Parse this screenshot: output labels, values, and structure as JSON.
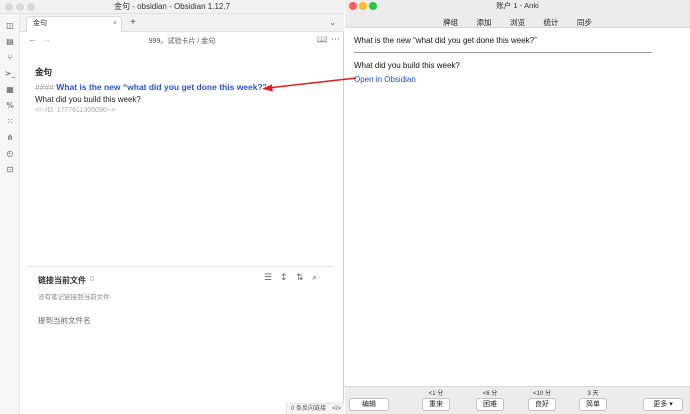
{
  "obsidian": {
    "window_title": "金句 - obsidian - Obsidian 1.12.7",
    "tab": {
      "label": "金句",
      "close": "×"
    },
    "new_tab": "+",
    "tab_menu": "⌄",
    "nav": {
      "back": "←",
      "forward": "→",
      "breadcrumb": "999。试验卡片 / 金句",
      "reading_icon": "📖",
      "more_icon": "⋯"
    },
    "note": {
      "title": "金句",
      "heading_marks": "####",
      "heading_text": "What is the new “what did you get done this week?”",
      "body": "What did you build this week?",
      "comment": "<!--ID: 1777611305090-->"
    },
    "backlinks": {
      "title": "链接当前文件",
      "count": "0",
      "empty_text": "没有笔记链接到当前文件",
      "mentions_title": "提到当前文件名"
    },
    "status": "0 条反向链接"
  },
  "anki": {
    "window_title": "账户 1 - Anki",
    "menu": [
      "牌组",
      "添加",
      "浏览",
      "统计",
      "同步"
    ],
    "card": {
      "front": "What is the new “what did you get done this week?”",
      "back": "What did you build this week?",
      "link": "Open in Obsidian"
    },
    "bottom": {
      "edit_label": "编辑",
      "more_label": "更多 ▾",
      "answers": [
        {
          "time": "<1 分",
          "label": "重来"
        },
        {
          "time": "<6 分",
          "label": "困难"
        },
        {
          "time": "<10 分",
          "label": "良好"
        },
        {
          "time": "3 天",
          "label": "简单"
        }
      ]
    }
  },
  "colors": {
    "heading_link": "#2b56c5",
    "anki_link": "#1d4fd8",
    "arrow": "#e02020"
  }
}
